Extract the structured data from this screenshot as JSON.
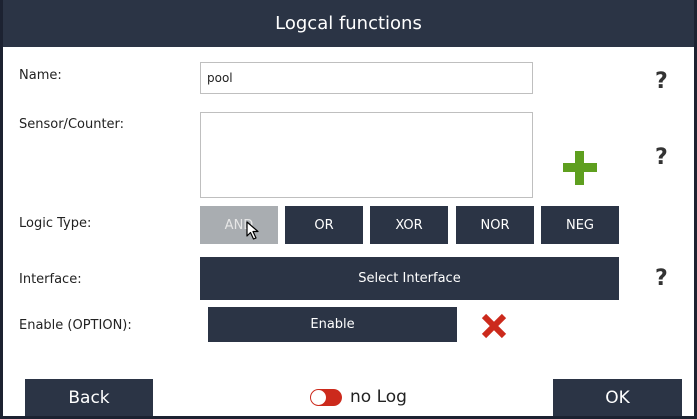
{
  "window": {
    "title": "Logcal functions"
  },
  "form": {
    "name_label": "Name:",
    "name_value": "pool",
    "sensor_label": "Sensor/Counter:",
    "sensor_value": "",
    "logic_type_label": "Logic Type:",
    "logic_buttons": [
      "AND",
      "OR",
      "XOR",
      "NOR",
      "NEG"
    ],
    "logic_selected": "AND",
    "interface_label": "Interface:",
    "interface_button": "Select Interface",
    "enable_label": "Enable (OPTION):",
    "enable_button": "Enable"
  },
  "help_text": "?",
  "footer": {
    "back_label": "Back",
    "log_toggle_label": "no Log",
    "log_enabled": false,
    "ok_label": "OK"
  },
  "icons": {
    "help": "question-mark",
    "add": "plus-icon",
    "remove": "x-icon",
    "pointer": "mouse-cursor-icon"
  },
  "colors": {
    "header_bg": "#2b3445",
    "button_bg": "#2b3445",
    "selected_button_bg": "#a9adb1",
    "plus_green": "#5e9f1f",
    "x_red": "#cc2a1c",
    "toggle_red": "#cc2a1c"
  }
}
